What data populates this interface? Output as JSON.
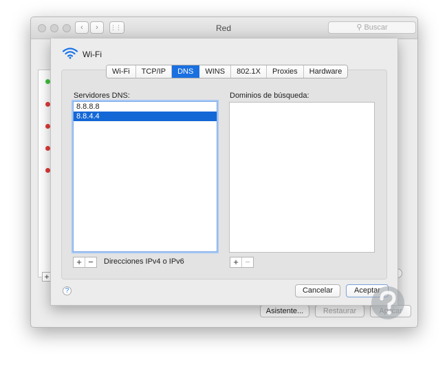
{
  "window": {
    "title": "Red",
    "search_placeholder": "Buscar",
    "buttons": {
      "assistant": "Asistente...",
      "restore": "Restaurar",
      "apply": "Aplicar"
    },
    "service_status": [
      "green",
      "red",
      "red",
      "red",
      "red"
    ],
    "colors": {
      "green": "#3ec43e",
      "red": "#e23b3b"
    }
  },
  "sheet": {
    "interface_name": "Wi-Fi",
    "tabs": [
      "Wi-Fi",
      "TCP/IP",
      "DNS",
      "WINS",
      "802.1X",
      "Proxies",
      "Hardware"
    ],
    "active_tab": "DNS",
    "dns": {
      "label": "Servidores DNS:",
      "servers": [
        "8.8.8.8",
        "8.8.4.4"
      ],
      "selected_index": 1,
      "hint": "Direcciones IPv4 o IPv6"
    },
    "search_domains": {
      "label": "Dominios de búsqueda:",
      "items": []
    },
    "buttons": {
      "cancel": "Cancelar",
      "accept": "Aceptar"
    },
    "icons": {
      "interface": "wifi-icon",
      "help": "help-icon",
      "add": "plus-icon",
      "remove": "minus-icon"
    },
    "accent_color": "#1a70e0"
  }
}
